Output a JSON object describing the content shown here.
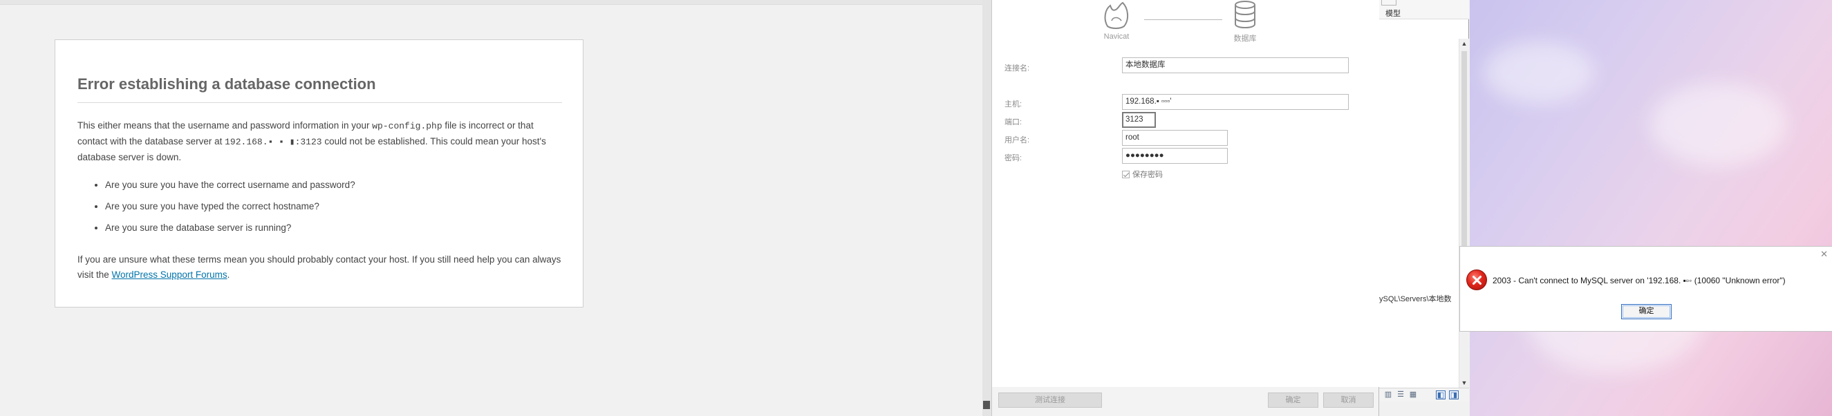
{
  "wordpress": {
    "title": "Error establishing a database connection",
    "message_part1": "This either means that the username and password information in your ",
    "config_file": "wp-config.php",
    "message_part2": " file is incorrect or that contact with the database server at ",
    "server": "192.168.▪ ▪ ▮:3123",
    "message_part3": " could not be established. This could mean your host's database server is down.",
    "checklist": [
      "Are you sure you have the correct username and password?",
      "Are you sure you have typed the correct hostname?",
      "Are you sure the database server is running?"
    ],
    "footer_part1": "If you are unsure what these terms mean you should probably contact your host. If you still need help you can always visit the ",
    "footer_link": "WordPress Support Forums",
    "footer_part2": "."
  },
  "navicat_dialog": {
    "icons": {
      "source": "Navicat",
      "target": "数据库",
      "source_icon": "navicat-logo-icon",
      "target_icon": "database-icon"
    },
    "fields": {
      "connection_name": {
        "label": "连接名:",
        "value": "本地数据库"
      },
      "host": {
        "label": "主机:",
        "value": "192.168.▪ ▫▫▫'"
      },
      "port": {
        "label": "端口:",
        "value": "3123"
      },
      "username": {
        "label": "用户名:",
        "value": "root"
      },
      "password": {
        "label": "密码:",
        "value": "●●●●●●●●"
      }
    },
    "save_password": "保存密码",
    "buttons": {
      "test": "测试连接",
      "ok": "确定",
      "cancel": "取消"
    }
  },
  "navicat_main": {
    "tab_label": "模型",
    "path_text": "ySQL\\Servers\\本地数",
    "status_icons": [
      "list-view-icon",
      "detail-view-icon",
      "grid-view-icon",
      "panel-left-icon",
      "panel-right-icon"
    ]
  },
  "error_dialog": {
    "message": "2003 - Can't connect to MySQL server on '192.168. ▪▫◦ (10060 \"Unknown error\")",
    "ok": "确定",
    "icon": "error-icon",
    "close": "✕"
  }
}
